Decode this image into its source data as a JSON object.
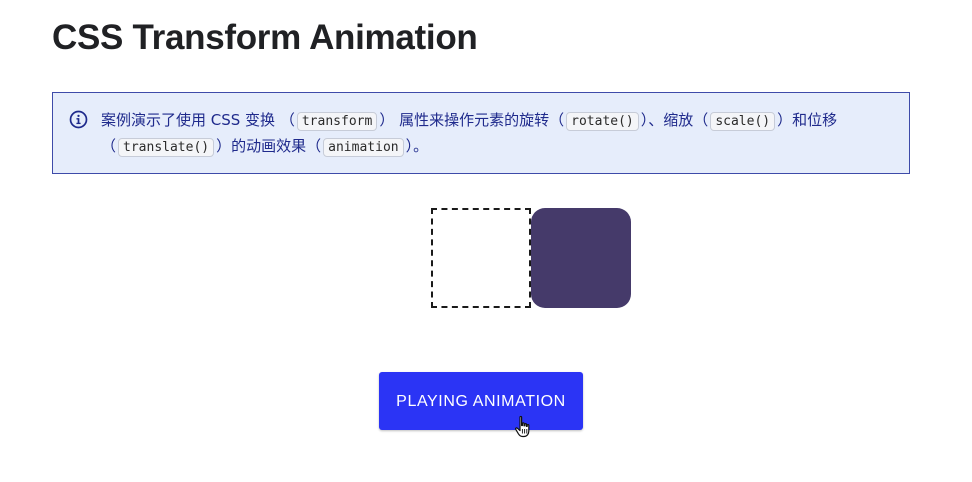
{
  "page": {
    "title": "CSS Transform Animation"
  },
  "info": {
    "icon": "info-circle-icon",
    "accent_color": "#3e4ba9",
    "background_color": "#e6edfb",
    "line1_text1": "案例演示了使用 CSS 变换",
    "line1_code1": "transform",
    "line1_text2": "属性来操作元素的旋转",
    "line1_code2": "rotate()",
    "line1_text3": "、缩放",
    "line1_code3": "scale()",
    "line1_text4": "和位移",
    "line2_code1": "translate()",
    "line2_text1": "的动画效果",
    "line2_code2": "animation",
    "line2_text2": "。",
    "paren_open": "（",
    "paren_close": "）"
  },
  "demo": {
    "animated_box_color": "#453a6a"
  },
  "button": {
    "label": "PLAYING ANIMATION",
    "color": "#2b34f5"
  },
  "cursor": {
    "icon": "hand-pointer-icon"
  }
}
